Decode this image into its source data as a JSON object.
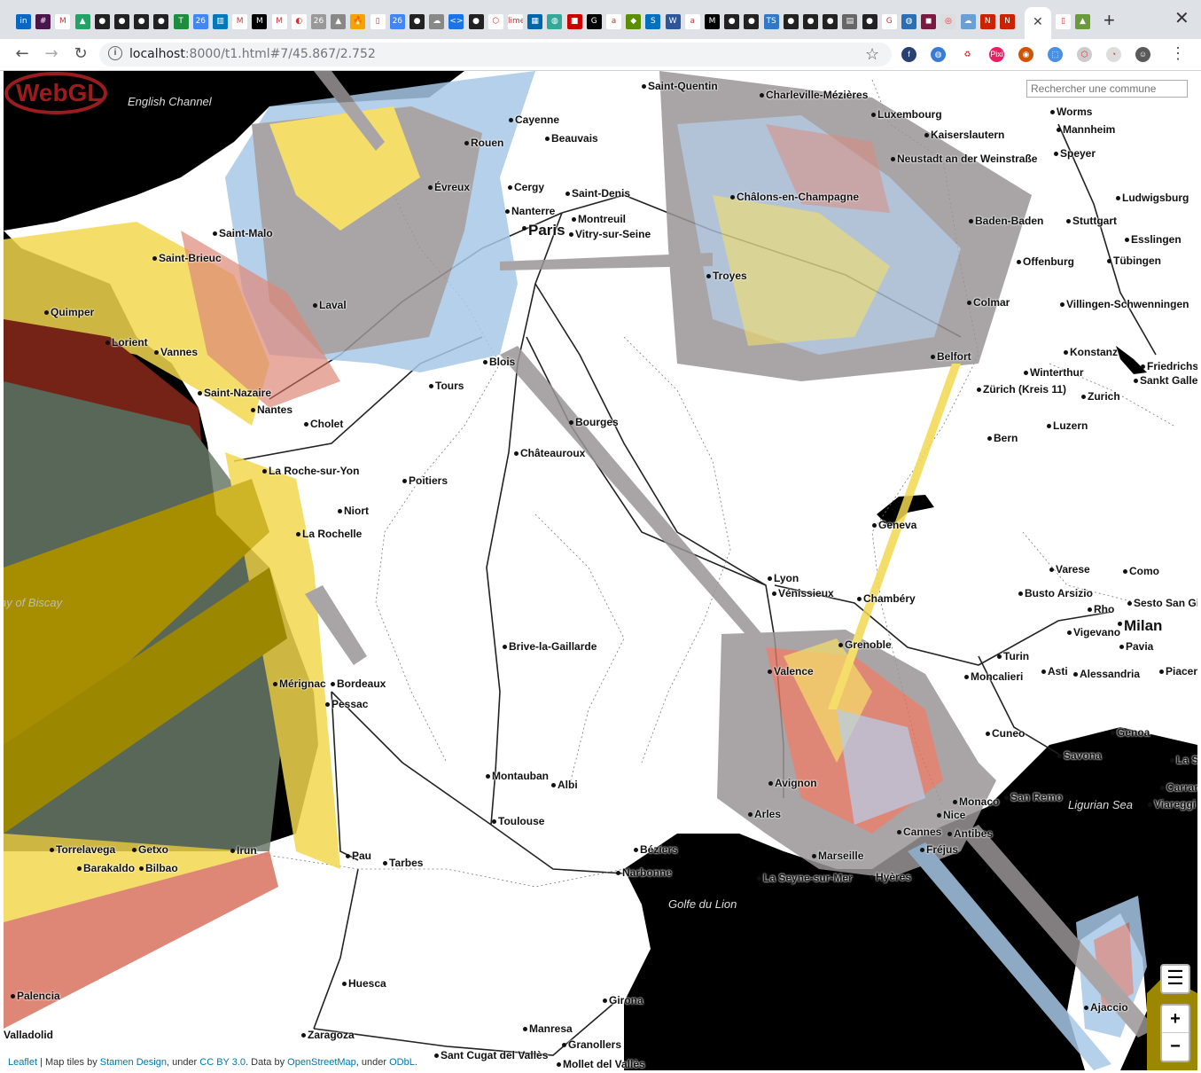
{
  "browser": {
    "favicons": [
      {
        "icon": "linkedin-icon",
        "color": "#0a66c2",
        "glyph": "in"
      },
      {
        "icon": "slack-icon",
        "color": "#4a154b",
        "glyph": "#"
      },
      {
        "icon": "gmail-icon",
        "color": "#ffffff",
        "glyph": "M"
      },
      {
        "icon": "drive-icon",
        "color": "#1fa463",
        "glyph": "▲"
      },
      {
        "icon": "github-icon",
        "color": "#222222",
        "glyph": "●"
      },
      {
        "icon": "github-icon",
        "color": "#222222",
        "glyph": "●"
      },
      {
        "icon": "github-icon",
        "color": "#222222",
        "glyph": "●"
      },
      {
        "icon": "github-icon",
        "color": "#222222",
        "glyph": "●"
      },
      {
        "icon": "sheets-icon",
        "color": "#1e8e3e",
        "glyph": "T"
      },
      {
        "icon": "calendar-icon",
        "color": "#4285f4",
        "glyph": "26"
      },
      {
        "icon": "trello-icon",
        "color": "#0079bf",
        "glyph": "▥"
      },
      {
        "icon": "gmail-icon",
        "color": "#ffffff",
        "glyph": "M"
      },
      {
        "icon": "medium-icon",
        "color": "#000000",
        "glyph": "M"
      },
      {
        "icon": "gmail-icon",
        "color": "#ffffff",
        "glyph": "M"
      },
      {
        "icon": "loading-icon",
        "color": "#ffffff",
        "glyph": "◐"
      },
      {
        "icon": "calendar-icon",
        "color": "#999999",
        "glyph": "26"
      },
      {
        "icon": "drive-icon",
        "color": "#888888",
        "glyph": "▲"
      },
      {
        "icon": "fire-icon",
        "color": "#f4a300",
        "glyph": "🔥"
      },
      {
        "icon": "page-icon",
        "color": "#ffffff",
        "glyph": "▯"
      },
      {
        "icon": "calendar-icon",
        "color": "#4285f4",
        "glyph": "26"
      },
      {
        "icon": "github-icon",
        "color": "#222222",
        "glyph": "●"
      },
      {
        "icon": "cloud-icon",
        "color": "#888888",
        "glyph": "☁"
      },
      {
        "icon": "code-icon",
        "color": "#1a73e8",
        "glyph": "<>"
      },
      {
        "icon": "github-icon",
        "color": "#222222",
        "glyph": "●"
      },
      {
        "icon": "box-icon",
        "color": "#ffffff",
        "glyph": "⬡"
      },
      {
        "icon": "lime-icon",
        "color": "#ffffff",
        "glyph": "lime"
      },
      {
        "icon": "grid-icon",
        "color": "#0066aa",
        "glyph": "▦"
      },
      {
        "icon": "globe-icon",
        "color": "#3a9",
        "glyph": "◍"
      },
      {
        "icon": "news-icon",
        "color": "#cc0000",
        "glyph": "■"
      },
      {
        "icon": "g-icon",
        "color": "#000000",
        "glyph": "G"
      },
      {
        "icon": "amazon-icon",
        "color": "#ffffff",
        "glyph": "a"
      },
      {
        "icon": "app-icon",
        "color": "#5a8f00",
        "glyph": "◆"
      },
      {
        "icon": "shop-icon",
        "color": "#0070c0",
        "glyph": "S"
      },
      {
        "icon": "word-icon",
        "color": "#2b579a",
        "glyph": "W"
      },
      {
        "icon": "amazon-icon",
        "color": "#ffffff",
        "glyph": "a"
      },
      {
        "icon": "medium-icon",
        "color": "#000000",
        "glyph": "M"
      },
      {
        "icon": "github-icon",
        "color": "#222222",
        "glyph": "●"
      },
      {
        "icon": "github-icon",
        "color": "#222222",
        "glyph": "●"
      },
      {
        "icon": "ts-icon",
        "color": "#3178c6",
        "glyph": "TS"
      },
      {
        "icon": "github-icon",
        "color": "#222222",
        "glyph": "●"
      },
      {
        "icon": "github-icon",
        "color": "#222222",
        "glyph": "●"
      },
      {
        "icon": "github-icon",
        "color": "#222222",
        "glyph": "●"
      },
      {
        "icon": "book-icon",
        "color": "#666666",
        "glyph": "▤"
      },
      {
        "icon": "github-icon",
        "color": "#222222",
        "glyph": "●"
      },
      {
        "icon": "google-icon",
        "color": "#ffffff",
        "glyph": "G"
      },
      {
        "icon": "globe-icon",
        "color": "#2a6fb5",
        "glyph": "◍"
      },
      {
        "icon": "avatar-icon",
        "color": "#7a1a40",
        "glyph": "◼"
      },
      {
        "icon": "chrome-icon",
        "color": "#dddddd",
        "glyph": "◎"
      },
      {
        "icon": "cloud-icon",
        "color": "#6a9fd4",
        "glyph": "☁"
      },
      {
        "icon": "notion-icon",
        "color": "#cc2200",
        "glyph": "N"
      },
      {
        "icon": "notion-icon",
        "color": "#cc2200",
        "glyph": "N"
      }
    ],
    "after_tab_favicons": [
      {
        "icon": "page-icon",
        "color": "#ffffff",
        "glyph": "▯"
      },
      {
        "icon": "image-icon",
        "color": "#6a9a3a",
        "glyph": "▲"
      }
    ],
    "url_host": "localhost",
    "url_rest": ":8000/t1.html#7/45.867/2.752",
    "extensions": [
      {
        "icon": "fedora-icon",
        "color": "#294172",
        "glyph": "f"
      },
      {
        "icon": "globe-ext-icon",
        "color": "#3a7bd5",
        "glyph": "◍"
      },
      {
        "icon": "recycle-icon",
        "color": "#ffffff",
        "glyph": "♻"
      },
      {
        "icon": "pixi-icon",
        "color": "#e91e63",
        "glyph": "Pixi"
      },
      {
        "icon": "target-icon",
        "color": "#d35400",
        "glyph": "◉"
      },
      {
        "icon": "ext-blue-icon",
        "color": "#4a90e2",
        "glyph": "⬚"
      },
      {
        "icon": "ext-gray-icon",
        "color": "#cccccc",
        "glyph": "⬡"
      },
      {
        "icon": "ext-light-icon",
        "color": "#dddddd",
        "glyph": "◔"
      },
      {
        "icon": "profile-icon",
        "color": "#5a5a5a",
        "glyph": "☺"
      }
    ]
  },
  "map": {
    "search_placeholder": "Rechercher une commune",
    "layers_glyph": "☰",
    "zoom_in": "+",
    "zoom_out": "−",
    "attribution": {
      "leaflet": "Leaflet",
      "sep1": " | Map tiles by ",
      "stamen": "Stamen Design",
      "sep2": ", under ",
      "ccby": "CC BY 3.0",
      "sep3": ". Data by ",
      "osm": "OpenStreetMap",
      "sep4": ", under ",
      "odbl": "ODbL",
      "end": "."
    },
    "seas": [
      {
        "name": "English Channel",
        "cls": "sea"
      },
      {
        "name": "ay of Biscay",
        "cls": "sea"
      },
      {
        "name": "Golfe du Lion",
        "cls": "sea"
      },
      {
        "name": "Ligurian Sea",
        "cls": "sea"
      }
    ],
    "cities": [
      "Saint-Quentin",
      "Charleville-Mézières",
      "Luxembourg",
      "Worms",
      "Mannheim",
      "Cayenne",
      "Beauvais",
      "Rouen",
      "Kaiserslautern",
      "Neustadt an der Weinstraße",
      "Speyer",
      "Évreux",
      "Cergy",
      "Saint-Denis",
      "Nanterre",
      "Montreuil",
      "Paris",
      "Vitry-sur-Seine",
      "Châlons-en-Champagne",
      "Ludwigsburg",
      "Stuttgart",
      "Baden-Baden",
      "Esslingen",
      "Saint-Malo",
      "Saint-Brieuc",
      "Offenburg",
      "Tübingen",
      "Troyes",
      "Quimper",
      "Laval",
      "Colmar",
      "Villingen-Schwenningen",
      "Lorient",
      "Vannes",
      "Blois",
      "Belfort",
      "Konstanz",
      "Friedrichs",
      "Winterthur",
      "Sankt Galler",
      "Tours",
      "Zürich (Kreis 11)",
      "Zurich",
      "Saint-Nazaire",
      "Nantes",
      "Cholet",
      "Bourges",
      "Luzern",
      "Bern",
      "Châteauroux",
      "La Roche-sur-Yon",
      "Poitiers",
      "Niort",
      "Geneva",
      "La Rochelle",
      "Lyon",
      "Vénissieux",
      "Chambéry",
      "Varese",
      "Como",
      "Busto Arsizio",
      "Sesto San Gio",
      "Rho",
      "Milan",
      "Vigevano",
      "Grenoble",
      "Pavia",
      "Brive-la-Gaillarde",
      "Turin",
      "Moncalieri",
      "Asti",
      "Alessandria",
      "Piacen",
      "Valence",
      "Mérignac",
      "Bordeaux",
      "Pessac",
      "Cuneo",
      "Genoa",
      "Savona",
      "La Sp",
      "Montauban",
      "Albi",
      "Avignon",
      "Carrara",
      "Viareggi",
      "Monaco",
      "San Remo",
      "Arles",
      "Nice",
      "Toulouse",
      "Cannes",
      "Antibes",
      "Fréjus",
      "Béziers",
      "Marseille",
      "Torrelavega",
      "Getxo",
      "Barakaldo",
      "Bilbao",
      "Irun",
      "Pau",
      "Tarbes",
      "Narbonne",
      "La Seyne-sur-Mer",
      "Hyères",
      "Ajaccio",
      "Huesca",
      "Palencia",
      "Girona",
      "Valladolid",
      "Manresa",
      "Zaragoza",
      "Granollers",
      "Sant Cugat del Vallès",
      "Mollet del Vallès"
    ],
    "city_overrides": {
      "Paris": "big",
      "Milan": "big"
    }
  },
  "colors": {
    "sea": "#000000",
    "overlay_gray": "#9a9596",
    "overlay_yellow": "#f2d94e",
    "overlay_blue": "#a8c8e8",
    "overlay_red": "#d9725f",
    "overlay_olive": "#b8a000"
  }
}
